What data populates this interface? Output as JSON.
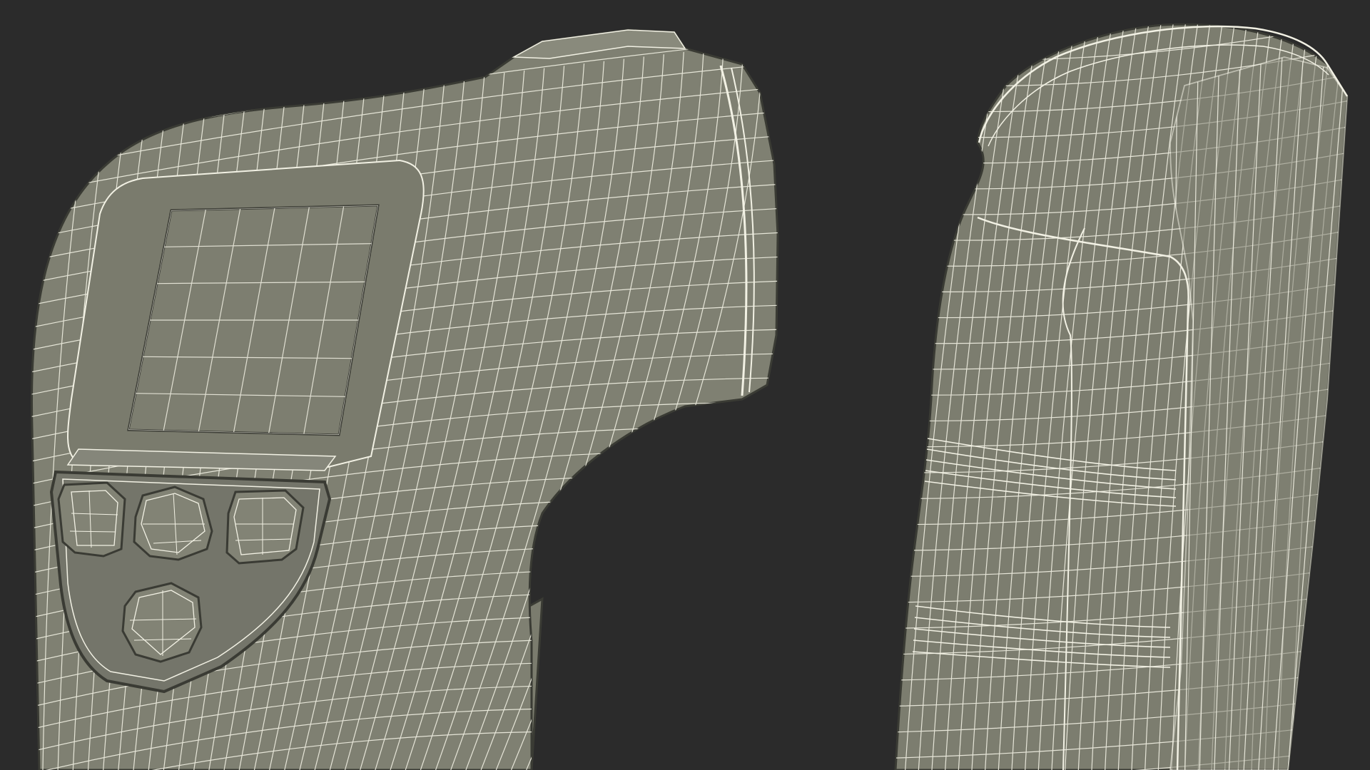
{
  "scene": {
    "background": "#2b2b2b",
    "mesh_fill": "#7d7e70",
    "mesh_fill_shadow": "#6f7062",
    "mesh_fill_light": "#898a7c",
    "wire_color": "#f2f1e4",
    "edge_color": "#3a3b34",
    "objects": [
      {
        "name": "thermometer-front-view",
        "part_count": 4
      },
      {
        "name": "thermometer-side-view",
        "part_count": 2
      }
    ]
  }
}
